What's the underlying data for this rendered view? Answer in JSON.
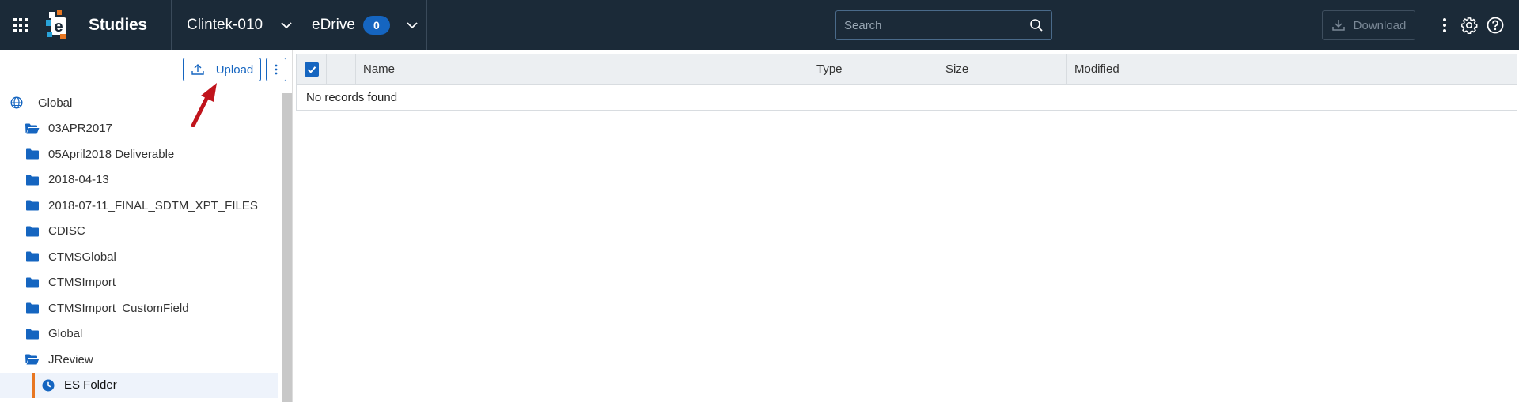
{
  "header": {
    "app_title": "Studies",
    "study": "Clintek-010",
    "edrive_label": "eDrive",
    "edrive_count": "0",
    "search_placeholder": "Search",
    "download_label": "Download"
  },
  "sidebar": {
    "upload_label": "Upload",
    "root_label": "Global",
    "items": [
      {
        "label": "03APR2017",
        "icon": "folder-open-icon"
      },
      {
        "label": "05April2018 Deliverable",
        "icon": "folder-icon"
      },
      {
        "label": "2018-04-13",
        "icon": "folder-icon"
      },
      {
        "label": "2018-07-11_FINAL_SDTM_XPT_FILES",
        "icon": "folder-icon"
      },
      {
        "label": "CDISC",
        "icon": "folder-icon"
      },
      {
        "label": "CTMSGlobal",
        "icon": "folder-icon"
      },
      {
        "label": "CTMSImport",
        "icon": "folder-icon"
      },
      {
        "label": "CTMSImport_CustomField",
        "icon": "folder-icon"
      },
      {
        "label": "Global",
        "icon": "folder-icon"
      },
      {
        "label": "JReview",
        "icon": "folder-open-icon"
      }
    ],
    "selected_item": {
      "label": "ES Folder",
      "icon": "clock-icon"
    }
  },
  "table": {
    "columns": [
      "Name",
      "Type",
      "Size",
      "Modified"
    ],
    "empty_message": "No records found"
  },
  "colors": {
    "topbar": "#1b2a38",
    "accent": "#1565c0",
    "selection_marker": "#e87722",
    "annotation_arrow": "#c0141c"
  }
}
